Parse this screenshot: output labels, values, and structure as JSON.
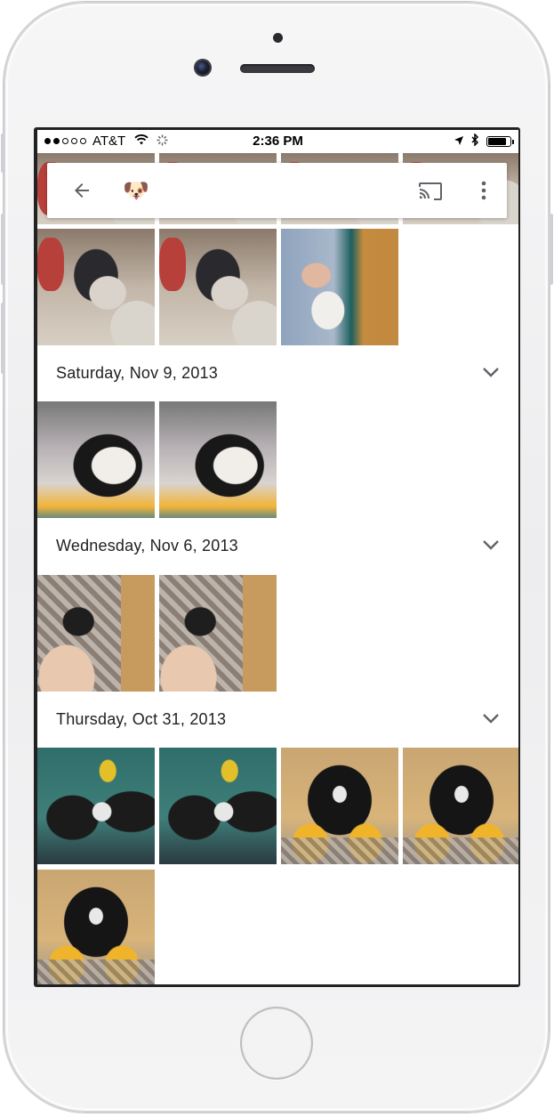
{
  "status_bar": {
    "carrier": "AT&T",
    "time": "2:36 PM",
    "battery_level": 0.85
  },
  "app_bar": {
    "face_emoji": "🐶",
    "icons": [
      "back-arrow-icon",
      "cast-icon",
      "more-vert-icon"
    ]
  },
  "sections": [
    {
      "date": "Saturday, Nov 9, 2013"
    },
    {
      "date": "Wednesday, Nov 6, 2013"
    },
    {
      "date": "Thursday, Oct 31, 2013"
    }
  ],
  "colors": {
    "text": "#202124",
    "icon": "#555555",
    "background": "#ffffff"
  }
}
